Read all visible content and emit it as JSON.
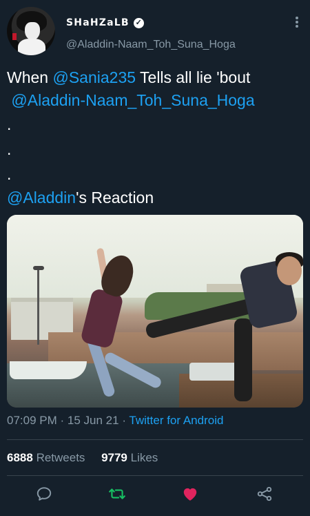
{
  "user": {
    "display_name": "SHaHZaLB",
    "handle": "@Aladdin-Naam_Toh_Suna_Hoga",
    "verified": true
  },
  "tweet": {
    "line1": {
      "prefix": "When ",
      "mention": "@Sania235",
      "suffix": " Tells all lie 'bout"
    },
    "line2": {
      "mention": "@Aladdin-Naam_Toh_Suna_Hoga"
    },
    "dots": [
      ".",
      ".",
      "."
    ],
    "line3": {
      "mention": "@Aladdin",
      "suffix": "'s Reaction"
    }
  },
  "meta": {
    "time": "07:09 PM",
    "separator": "·",
    "date": "15 Jun 21",
    "source": "Twitter for Android"
  },
  "stats": {
    "retweets_count": "6888",
    "retweets_label": "Retweets",
    "likes_count": "9779",
    "likes_label": "Likes"
  },
  "actions": [
    "reply-icon",
    "retweet-icon",
    "like-icon",
    "share-icon"
  ],
  "colors": {
    "background": "#15202b",
    "accent": "#1da1f2",
    "muted": "#8899a6",
    "retweet": "#17bf63",
    "like": "#e0245e"
  }
}
